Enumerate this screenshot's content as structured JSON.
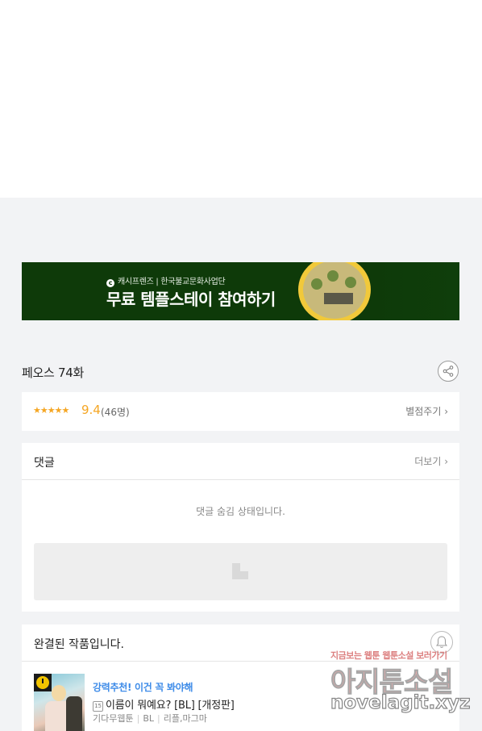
{
  "banner": {
    "brand": "캐시프렌즈 | 한국불교문화사업단",
    "headline": "무료 템플스테이 참여하기"
  },
  "episode": {
    "title": "페오스 74화"
  },
  "rating": {
    "stars": "★★★★★",
    "score": "9.4",
    "count": "(46명)",
    "rate_link": "별점주기 ›"
  },
  "comments": {
    "title": "댓글",
    "more_link": "더보기 ›",
    "hidden_message": "댓글 숨김 상태입니다."
  },
  "completed": {
    "title": "완결된 작품입니다.",
    "recommend_label": "강력추천! 이건 꼭 봐야해",
    "age_badge": "15",
    "work_title": "이름이 뭐예요? [BL] [개정판]",
    "meta": [
      "기다무웹툰",
      "BL",
      "리플,마그마"
    ]
  },
  "watermark": {
    "line1": "지금보는 웹툰 웹툰소설 보러가기",
    "line2": "아지툰소설",
    "line3": "novelagit.xyz"
  },
  "colors": {
    "accent_orange": "#f5a623",
    "link_blue": "#3d8be8",
    "banner_green": "#0e3a09"
  }
}
